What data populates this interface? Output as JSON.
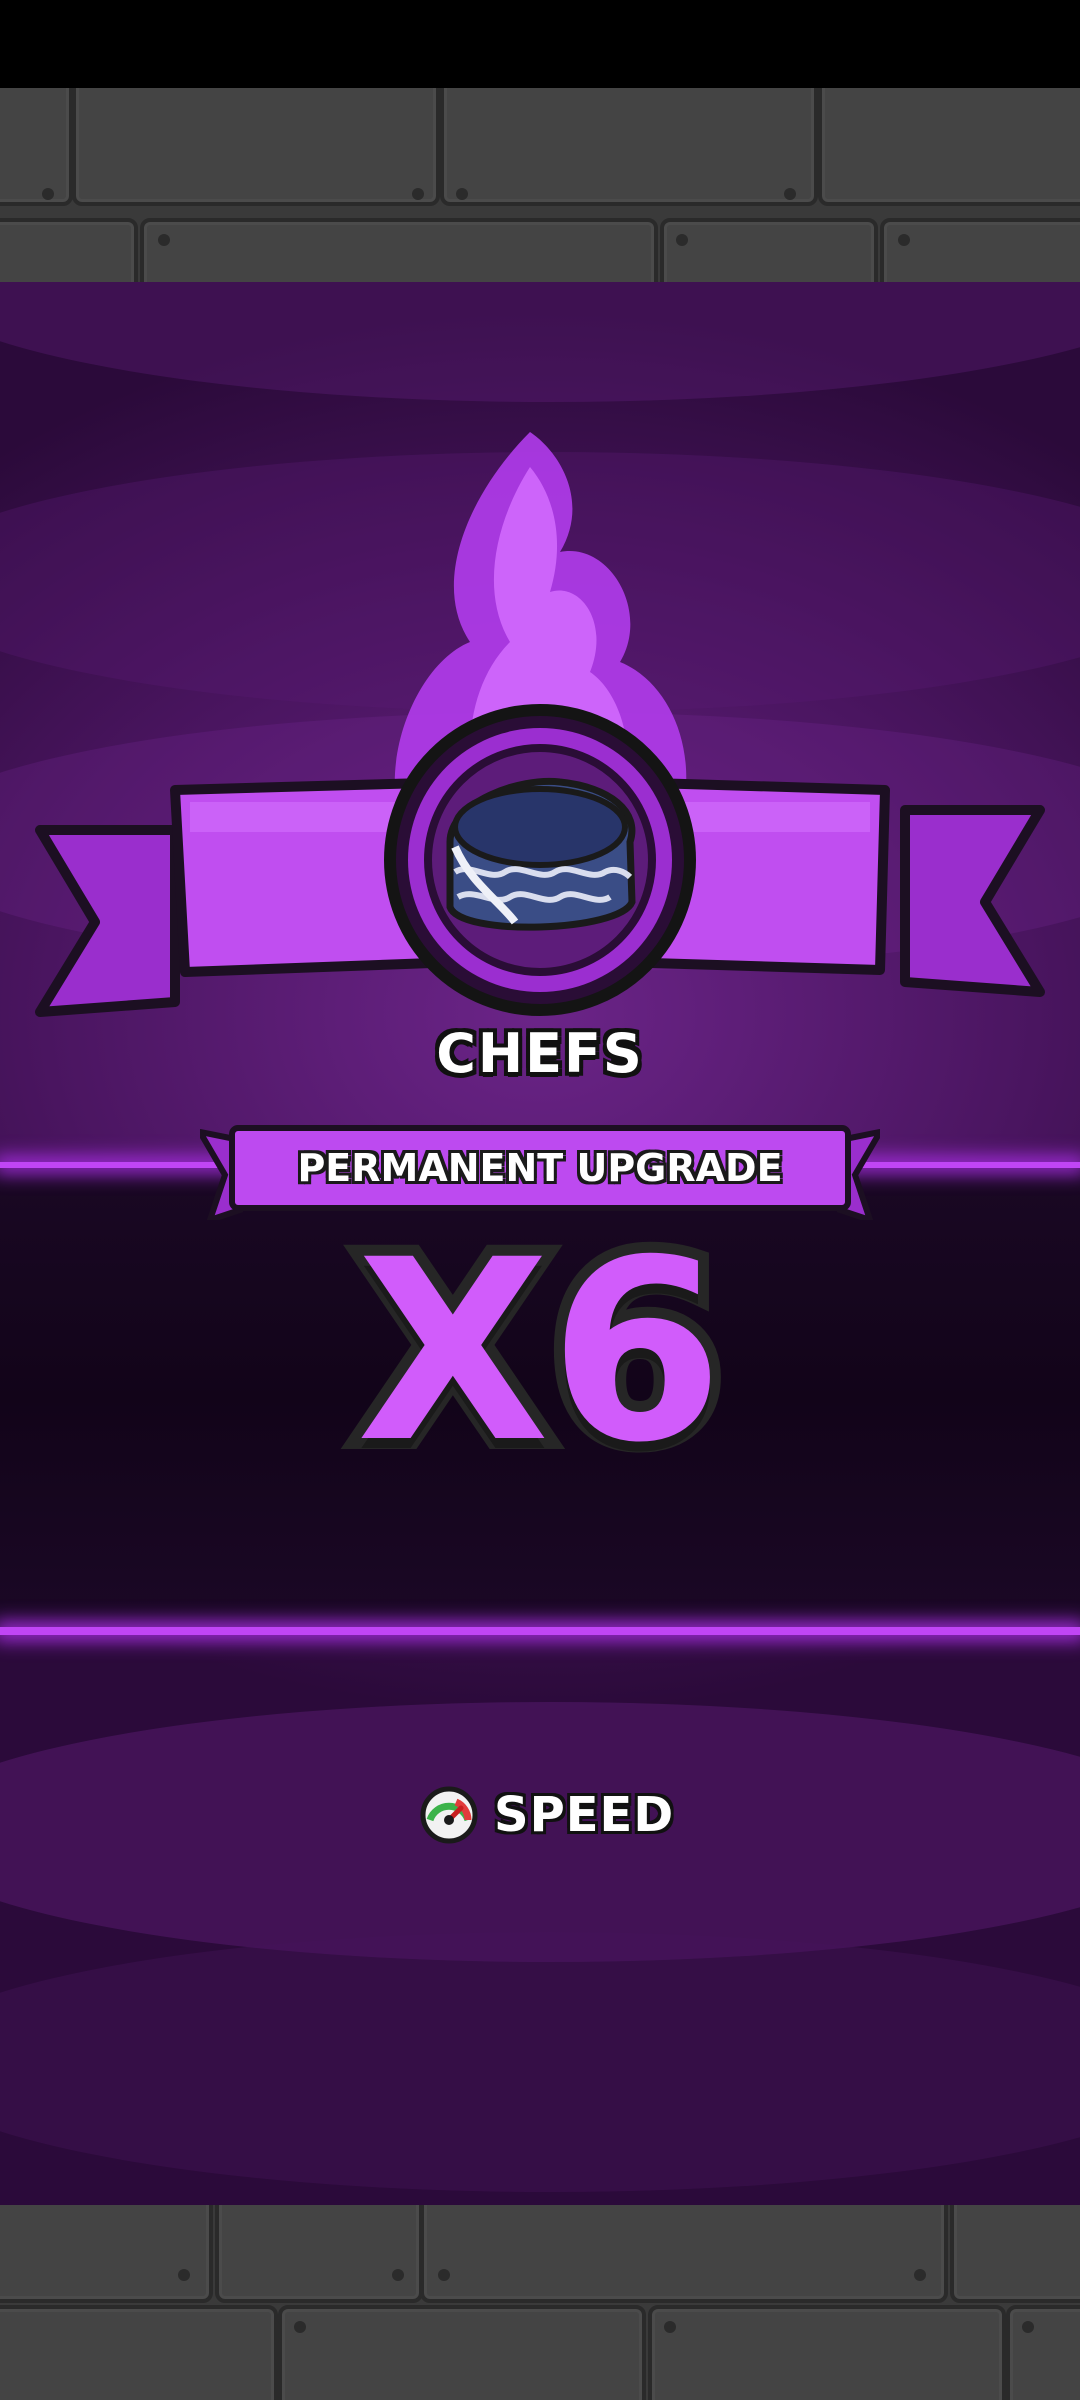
{
  "reward": {
    "title": "CHEFS",
    "subtitle": "PERMANENT UPGRADE",
    "multiplier": "X6",
    "stat_label": "SPEED",
    "stat_icon": "speedometer-icon",
    "item_icon": "chef-hat-icon"
  },
  "colors": {
    "accent": "#d15cfb",
    "banner": "#b84de6",
    "panel": "#4a1560",
    "dark_band": "#120419"
  }
}
